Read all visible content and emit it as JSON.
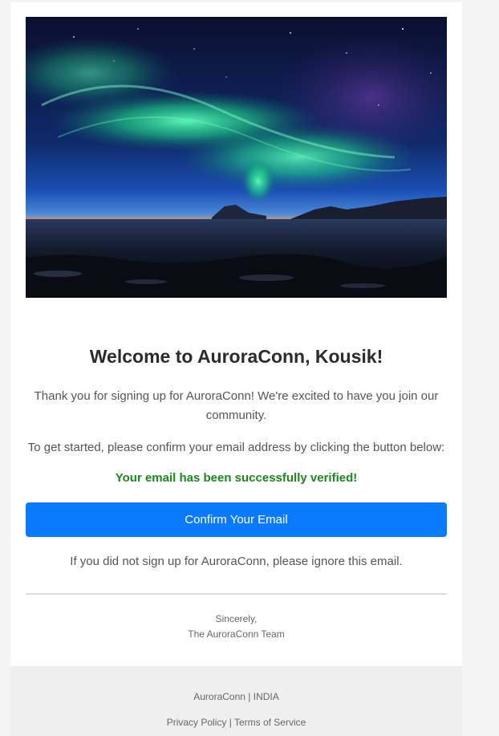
{
  "email": {
    "hero_image": {
      "alt": "Aurora borealis over water at dusk",
      "icon": "aurora-landscape-image"
    },
    "title": "Welcome to AuroraConn, Kousik!",
    "intro": "Thank you for signing up for AuroraConn! We're excited to have you join our community.",
    "instruction": "To get started, please confirm your email address by clicking the button below:",
    "status_message": "Your email has been successfully verified!",
    "confirm_button_label": "Confirm Your Email",
    "ignore_notice": "If you did not sign up for AuroraConn, please ignore this email.",
    "signoff": {
      "closing": "Sincerely,",
      "team": "The AuroraConn Team"
    }
  },
  "footer": {
    "company_line": "AuroraConn | INDIA",
    "privacy_link": "Privacy Policy",
    "separator": " | ",
    "terms_link": "Terms of Service"
  },
  "colors": {
    "accent": "#0a7bff",
    "success": "#1a8a1a",
    "title": "#2b2b2b",
    "body_text": "#555555",
    "footer_bg": "#efefef"
  }
}
